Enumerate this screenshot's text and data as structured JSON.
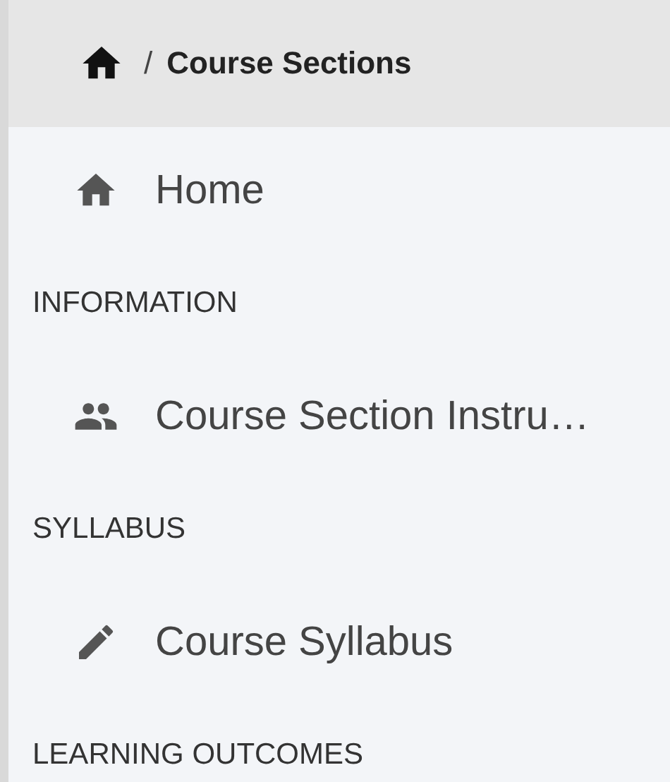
{
  "breadcrumb": {
    "separator": "/",
    "current": "Course Sections"
  },
  "nav": [
    {
      "kind": "home",
      "label": "Home"
    },
    {
      "kind": "section",
      "label": "INFORMATION"
    },
    {
      "kind": "people",
      "label": "Course Section Instru…"
    },
    {
      "kind": "section",
      "label": "SYLLABUS"
    },
    {
      "kind": "edit",
      "label": "Course Syllabus"
    },
    {
      "kind": "section",
      "label": "LEARNING OUTCOMES"
    }
  ]
}
